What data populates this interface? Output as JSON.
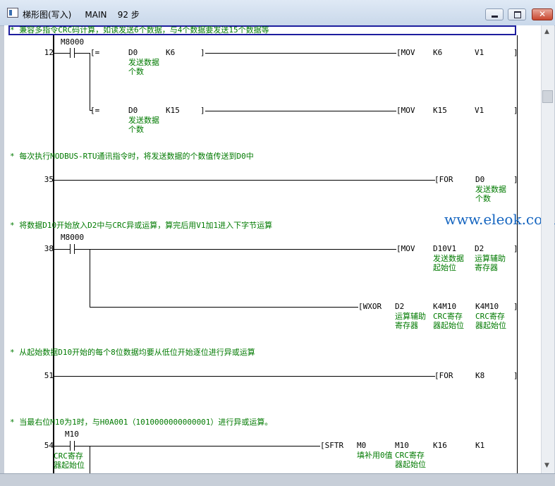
{
  "window": {
    "title": "梯形图(写入)     MAIN    92 步",
    "icon": "ladder-window-icon",
    "close_label": "✕"
  },
  "comments": [
    "* 兼容多指令CRC码计算，如读发送6个数据，与4个数据要发送15个数据等",
    "* 每次执行MODBUS-RTU通讯指令时，将发送数据的个数值传送到D0中",
    "* 将数据D10开始放入D2中与CRC异或运算，算完后用V1加1进入下字节运算",
    "* 从起始数据D10开始的每个8位数据均要从低位开始逐位进行异或运算",
    "* 当最右位M10为1时，与H0A001（1010000000000001）进行异或运算。"
  ],
  "step_numbers": [
    "12",
    "35",
    "38",
    "51",
    "54"
  ],
  "contacts": {
    "c12": {
      "device": "M8000"
    },
    "c38": {
      "device": "M8000"
    },
    "c54": {
      "device": "M10",
      "note": "CRC寄存\n器起始位"
    }
  },
  "instructions": {
    "cmp1": {
      "op": "[=",
      "a1": "D0",
      "a2": "K6",
      "c1": "发送数据\n个数"
    },
    "mov1": {
      "op": "[MOV",
      "a1": "K6",
      "a2": "V1"
    },
    "cmp2": {
      "op": "[=",
      "a1": "D0",
      "a2": "K15",
      "c1": "发送数据\n个数"
    },
    "mov2": {
      "op": "[MOV",
      "a1": "K15",
      "a2": "V1"
    },
    "for1": {
      "op": "[FOR",
      "a1": "D0",
      "c1": "发送数据\n个数"
    },
    "mov3": {
      "op": "[MOV",
      "a1": "D10V1",
      "a2": "D2",
      "c1": "发送数据\n起始位",
      "c2": "运算辅助\n寄存器"
    },
    "wxor": {
      "op": "[WXOR",
      "a1": "D2",
      "a2": "K4M10",
      "a3": "K4M10",
      "c1": "运算辅助\n寄存器",
      "c2": "CRC寄存\n器起始位",
      "c3": "CRC寄存\n器起始位"
    },
    "for2": {
      "op": "[FOR",
      "a1": "K8"
    },
    "sftr": {
      "op": "[SFTR",
      "a1": "M0",
      "a2": "M10",
      "a3": "K16",
      "a4": "K1",
      "c1": "填补用0值",
      "c2": "CRC寄存\n器起始位"
    }
  },
  "watermark": "www.eleok.com"
}
